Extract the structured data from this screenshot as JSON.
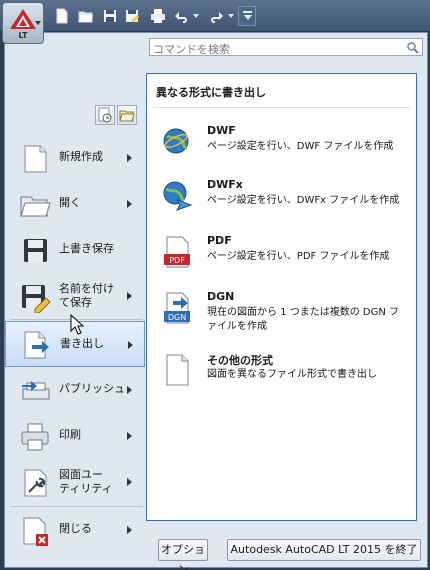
{
  "app": {
    "button_label": "LT"
  },
  "search": {
    "placeholder": "コマンドを検索"
  },
  "nav": {
    "items": [
      {
        "label": "新規作成",
        "icon": "new-document-icon",
        "arrow": true
      },
      {
        "label": "開く",
        "icon": "folder-open-icon",
        "arrow": true
      },
      {
        "label": "上書き保存",
        "icon": "save-icon",
        "arrow": false
      },
      {
        "label": "名前を付けて保存",
        "icon": "save-as-icon",
        "arrow": true
      },
      {
        "label": "書き出し",
        "icon": "export-icon",
        "arrow": true,
        "active": true
      },
      {
        "label": "パブリッシュ",
        "icon": "publish-icon",
        "arrow": true
      },
      {
        "label": "印刷",
        "icon": "print-icon",
        "arrow": true
      },
      {
        "label": "図面ユーティリティ",
        "icon": "drawing-utilities-icon",
        "arrow": true
      },
      {
        "label": "閉じる",
        "icon": "close-document-icon",
        "arrow": true
      }
    ]
  },
  "export_panel": {
    "header": "異なる形式に書き出し",
    "options": [
      {
        "title": "DWF",
        "desc": "ページ設定を行い、DWF ファイルを作成",
        "icon": "dwf-globe-icon"
      },
      {
        "title": "DWFx",
        "desc": "ページ設定を行い、DWFx ファイルを作成",
        "icon": "dwfx-globe-icon"
      },
      {
        "title": "PDF",
        "desc": "ページ設定を行い、PDF ファイルを作成",
        "icon": "pdf-icon",
        "badge": "PDF"
      },
      {
        "title": "DGN",
        "desc": "現在の図面から 1 つまたは複数の DGN ファイルを作成",
        "icon": "dgn-icon",
        "badge": "DGN"
      },
      {
        "title": "その他の形式",
        "desc": "図面を異なるファイル形式で書き出し",
        "icon": "other-format-icon"
      }
    ]
  },
  "buttons": {
    "options": "オプション",
    "exit": "Autodesk AutoCAD LT 2015 を終了"
  },
  "colors": {
    "accent": "#3d6fb0",
    "active_bg": "#c6dcf5",
    "pdf_red": "#c8282d",
    "dgn_blue": "#2d6fb7"
  }
}
